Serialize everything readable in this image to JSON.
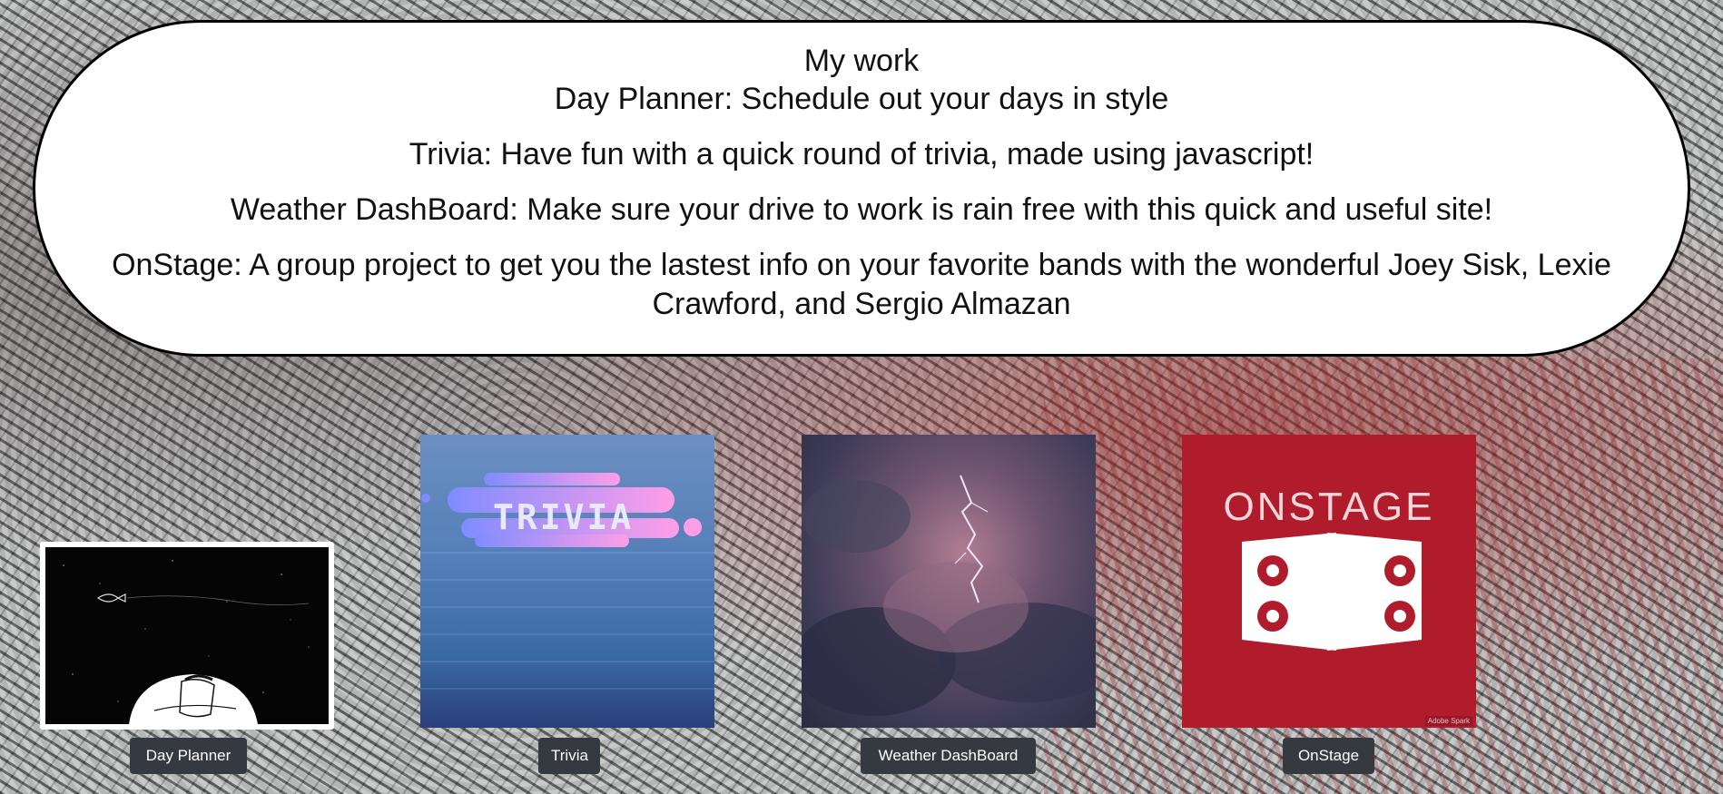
{
  "header": {
    "title": "My work",
    "descriptions": [
      "Day Planner: Schedule out your days in style",
      "Trivia: Have fun with a quick round of trivia, made using javascript!",
      "Weather DashBoard: Make sure your drive to work is rain free with this quick and useful site!",
      "OnStage: A group project to get you the lastest info on your favorite bands with the wonderful Joey Sisk, Lexie Crawford, and Sergio Almazan"
    ]
  },
  "projects": [
    {
      "label": "Day Planner",
      "image_icon": "moon-sleeper-illustration"
    },
    {
      "label": "Trivia",
      "image_icon": "trivia-logo",
      "image_text": "TRIVIA"
    },
    {
      "label": "Weather DashBoard",
      "image_icon": "lightning-storm-photo"
    },
    {
      "label": "OnStage",
      "image_icon": "onstage-speakers-logo",
      "image_text": "ONSTAGE",
      "image_badge": "Adobe Spark"
    }
  ],
  "colors": {
    "button_bg": "#343a40",
    "header_bg": "#ffffff",
    "onstage_red": "#b11c2c"
  }
}
